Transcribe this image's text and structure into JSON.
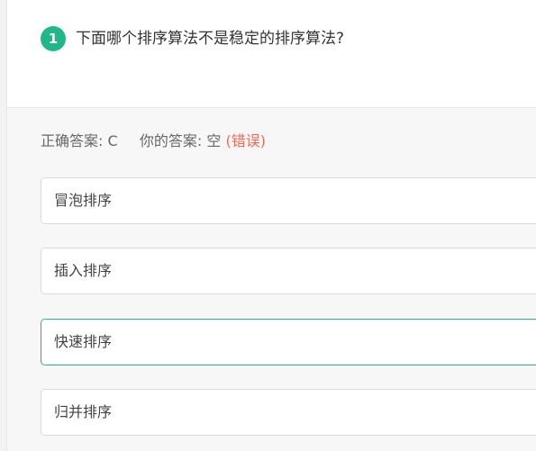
{
  "question": {
    "number": "1",
    "text": "下面哪个排序算法不是稳定的排序算法?"
  },
  "answer": {
    "correct_label": "正确答案:",
    "correct_value": "C",
    "your_label": "你的答案:",
    "your_value": "空",
    "status": "(错误)"
  },
  "options": [
    {
      "label": "冒泡排序"
    },
    {
      "label": "插入排序"
    },
    {
      "label": "快速排序"
    },
    {
      "label": "归并排序"
    }
  ],
  "colors": {
    "accent": "#20b889",
    "error": "#f06b55",
    "panel_bg": "#f7f7f7"
  }
}
